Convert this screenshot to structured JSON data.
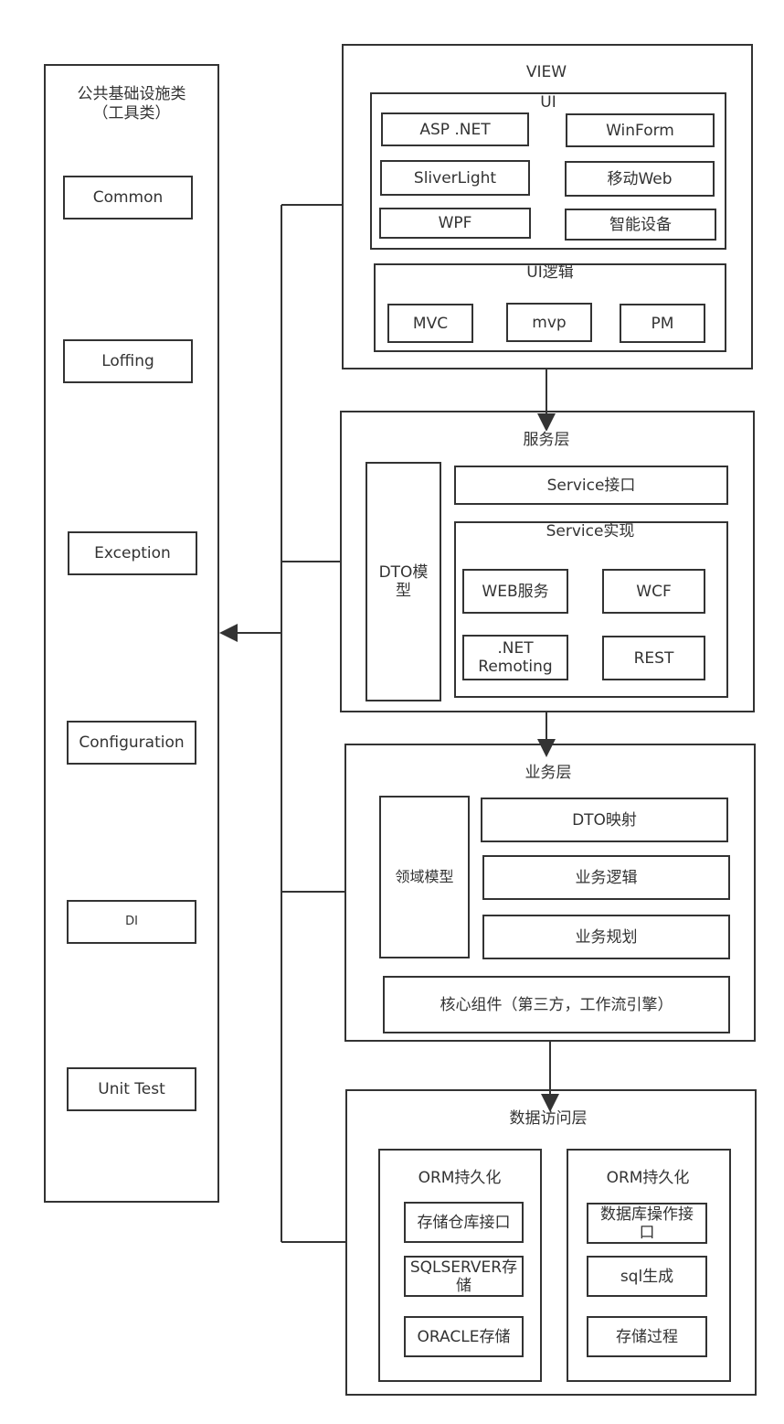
{
  "tools": {
    "title_line1": "公共基础设施类",
    "title_line2": "（工具类）",
    "items": [
      "Common",
      "Loffing",
      "Exception",
      "Configuration",
      "DI",
      "Unit Test"
    ]
  },
  "view": {
    "title": "VIEW",
    "ui": {
      "title": "UI",
      "items": [
        "ASP .NET",
        "WinForm",
        "SliverLight",
        "移动Web",
        "WPF",
        "智能设备"
      ]
    },
    "ui_logic": {
      "title": "UI逻辑",
      "items": [
        "MVC",
        "mvp",
        "PM"
      ]
    }
  },
  "service": {
    "title": "服务层",
    "dto_model": "DTO模型",
    "interface": "Service接口",
    "impl": {
      "title": "Service实现",
      "items": [
        "WEB服务",
        "WCF",
        ".NET Remoting",
        "REST"
      ]
    }
  },
  "business": {
    "title": "业务层",
    "domain_model": "领域模型",
    "items": [
      "DTO映射",
      "业务逻辑",
      "业务规划"
    ],
    "core": "核心组件（第三方，工作流引擎）"
  },
  "data_access": {
    "title": "数据访问层",
    "left": {
      "title": "ORM持久化",
      "items": [
        "存储仓库接口",
        "SQLSERVER存储",
        "ORACLE存储"
      ]
    },
    "right": {
      "title": "ORM持久化",
      "items": [
        "数据库操作接口",
        "sql生成",
        "存储过程"
      ]
    }
  }
}
